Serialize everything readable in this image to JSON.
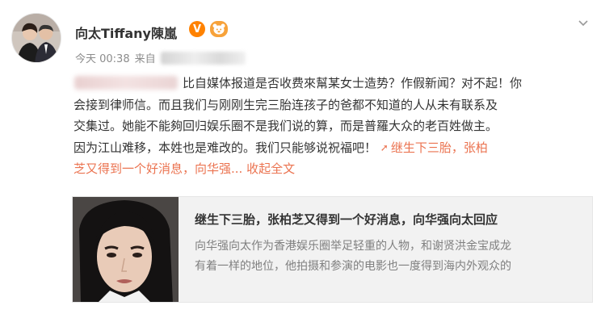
{
  "header": {
    "username": "向太Tiffany陳嵐",
    "verified_badge": "V",
    "member_badge": "熊",
    "chevron_icon": "chevron-down-icon"
  },
  "meta": {
    "time": "今天 00:38",
    "source_prefix": "来自"
  },
  "post": {
    "lines": [
      "比自媒体报道是否收费來幫某女士造势？作假新闻？对不起！你",
      "会接到律师信。而且我们与刚刚生完三胎连孩子的爸都不知道的人从未有联系及",
      "交集过。她能不能夠回归娱乐圈不是我们说的算，而是普羅大众的老百姓做主。",
      "因为江山难移，本姓也是难改的。我们只能够说祝福吧！"
    ],
    "topic_link_part1": "继生下三胎，张柏",
    "topic_link_part2": "芝又得到一个好消息，向华强...",
    "collapse_label": "收起全文"
  },
  "card": {
    "title": "继生下三胎，张柏芝又得到一个好消息，向华强向太回应",
    "desc_lines": [
      "向华强向太作为香港娱乐圈举足轻重的人物，和谢贤洪金宝成龙",
      "有着一样的地位，他拍摄和参演的电影也一度得到海内外观众的"
    ]
  },
  "colors": {
    "link": "#eb7350",
    "verified": "#ff8200",
    "text": "#333333",
    "muted": "#8c8c8c",
    "card_bg": "#f2f2f2"
  }
}
